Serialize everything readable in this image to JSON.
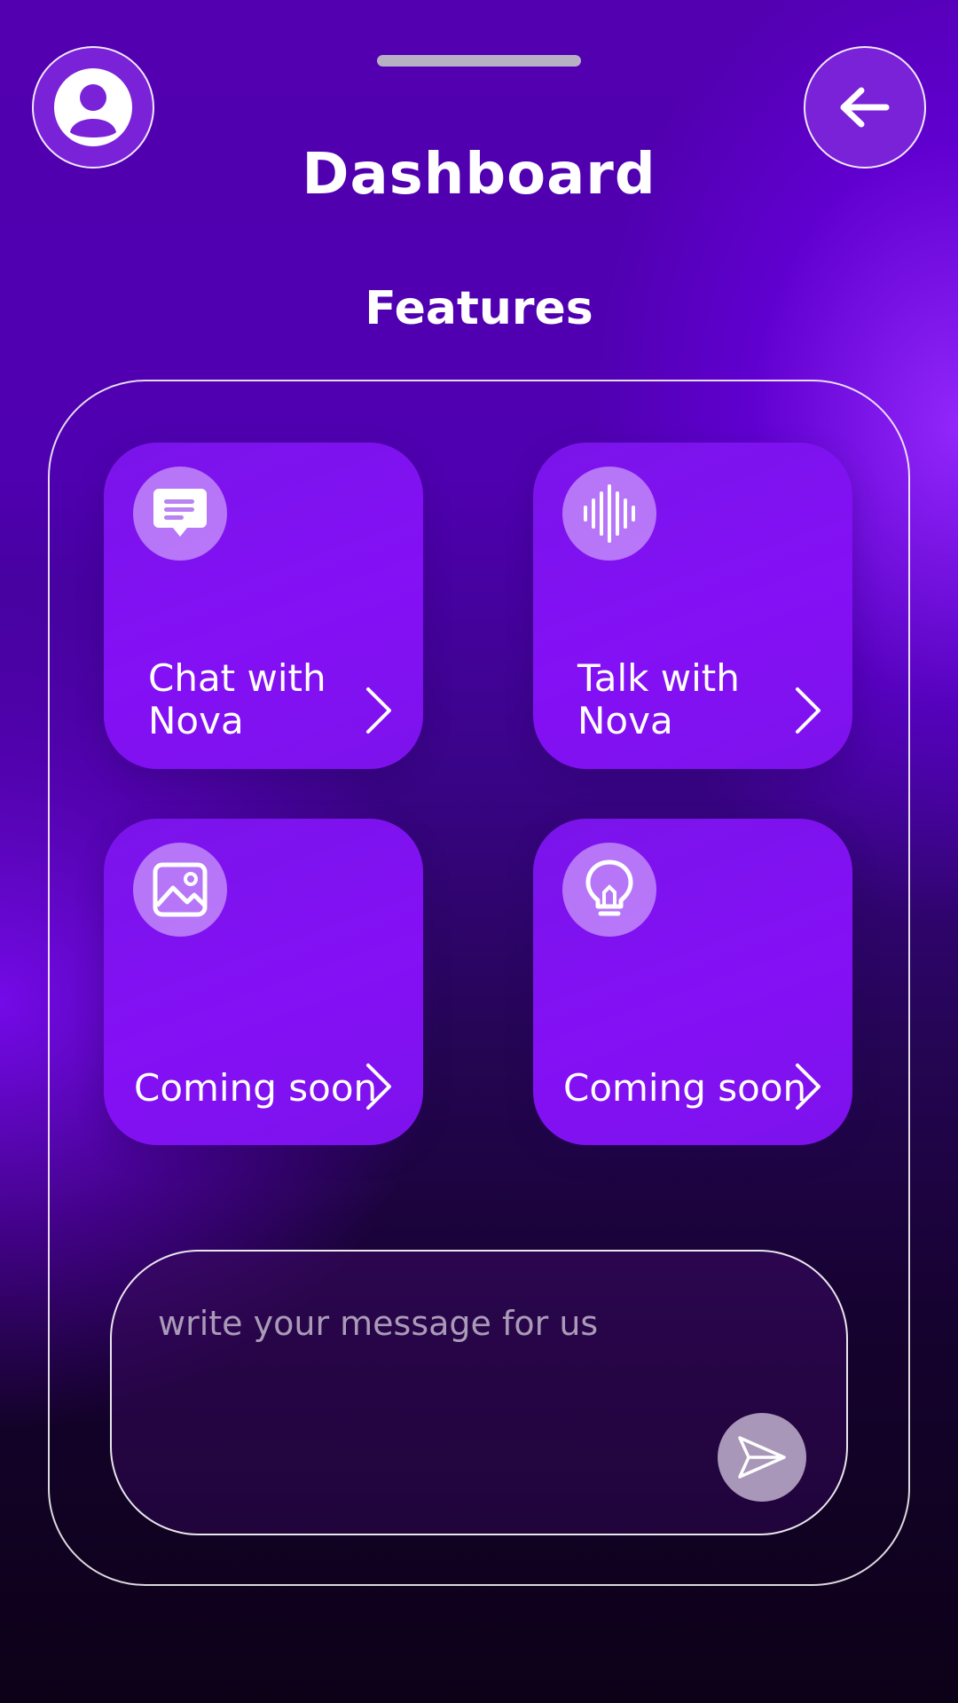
{
  "header": {
    "title": "Dashboard",
    "avatar_icon": "user-circle-icon",
    "back_icon": "arrow-left-icon"
  },
  "section": {
    "title": "Features"
  },
  "cards": [
    {
      "line1": "Chat with",
      "line2": "Nova",
      "icon": "chat-bubble-icon"
    },
    {
      "line1": "Talk with",
      "line2": "Nova",
      "icon": "sound-wave-icon"
    },
    {
      "label": "Coming soon",
      "icon": "image-icon"
    },
    {
      "label": "Coming soon",
      "icon": "lightbulb-icon"
    }
  ],
  "composer": {
    "placeholder": "write your message for us",
    "send_icon": "send-icon"
  },
  "colors": {
    "background_top": "#5200b0",
    "background_bottom": "#0d0118",
    "card": "#8410f5",
    "text": "#ffffff"
  }
}
